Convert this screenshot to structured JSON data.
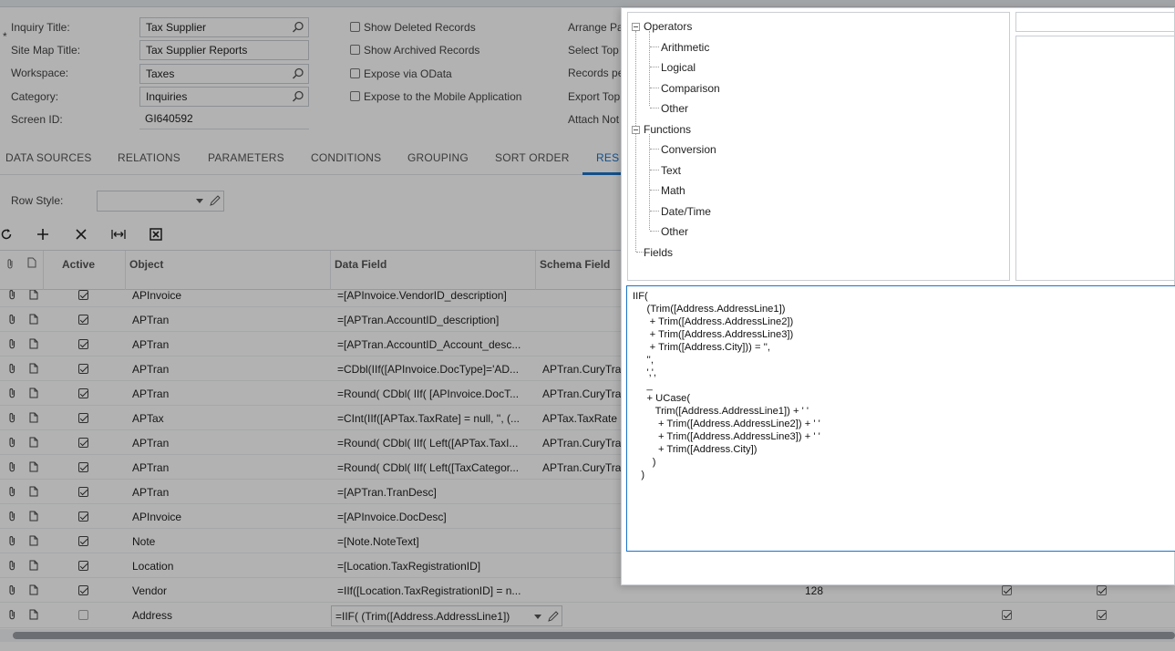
{
  "form": {
    "inquiry_title_label": "Inquiry Title:",
    "inquiry_title_value": "Tax Supplier",
    "site_map_title_label": "Site Map Title:",
    "site_map_title_value": "Tax Supplier Reports",
    "workspace_label": "Workspace:",
    "workspace_value": "Taxes",
    "category_label": "Category:",
    "category_value": "Inquiries",
    "screen_id_label": "Screen ID:",
    "screen_id_value": "GI640592",
    "checkboxes": [
      {
        "label": "Show Deleted Records",
        "checked": false
      },
      {
        "label": "Show Archived Records",
        "checked": false
      },
      {
        "label": "Expose via OData",
        "checked": false
      },
      {
        "label": "Expose to the Mobile Application",
        "checked": false
      }
    ],
    "right_labels": [
      "Arrange Pa",
      "Select Top",
      "Records pe",
      "Export Top",
      "Attach Not"
    ]
  },
  "tabs": [
    "DATA SOURCES",
    "RELATIONS",
    "PARAMETERS",
    "CONDITIONS",
    "GROUPING",
    "SORT ORDER",
    "RES"
  ],
  "active_tab": "RES",
  "row_style_label": "Row Style:",
  "grid": {
    "headers": {
      "active": "Active",
      "object": "Object",
      "data_field": "Data Field",
      "schema_field": "Schema Field"
    },
    "rows": [
      {
        "active": true,
        "object": "APInvoice",
        "data_field": "=[APInvoice.VendorID_description]",
        "schema_field": "",
        "extra": ""
      },
      {
        "active": true,
        "object": "APTran",
        "data_field": "=[APTran.AccountID_description]",
        "schema_field": "",
        "extra": ""
      },
      {
        "active": true,
        "object": "APTran",
        "data_field": "=[APTran.AccountID_Account_desc...",
        "schema_field": "",
        "extra": ""
      },
      {
        "active": true,
        "object": "APTran",
        "data_field": "=CDbl(IIf([APInvoice.DocType]='AD...",
        "schema_field": "APTran.CuryTra",
        "extra": ""
      },
      {
        "active": true,
        "object": "APTran",
        "data_field": "=Round( CDbl( IIf( [APInvoice.DocT...",
        "schema_field": "APTran.CuryTra",
        "extra": ""
      },
      {
        "active": true,
        "object": "APTax",
        "data_field": "=CInt(IIf([APTax.TaxRate] = null, '', (...",
        "schema_field": "APTax.TaxRate",
        "extra": ""
      },
      {
        "active": true,
        "object": "APTran",
        "data_field": "=Round( CDbl( IIf( Left([APTax.TaxI...",
        "schema_field": "APTran.CuryTra",
        "extra": ""
      },
      {
        "active": true,
        "object": "APTran",
        "data_field": "=Round( CDbl( IIf( Left([TaxCategor...",
        "schema_field": "APTran.CuryTra",
        "extra": ""
      },
      {
        "active": true,
        "object": "APTran",
        "data_field": "=[APTran.TranDesc]",
        "schema_field": "",
        "extra": ""
      },
      {
        "active": true,
        "object": "APInvoice",
        "data_field": "=[APInvoice.DocDesc]",
        "schema_field": "",
        "extra": ""
      },
      {
        "active": true,
        "object": "Note",
        "data_field": "=[Note.NoteText]",
        "schema_field": "",
        "extra": ""
      },
      {
        "active": true,
        "object": "Location",
        "data_field": "=[Location.TaxRegistrationID]",
        "schema_field": "",
        "extra": ""
      },
      {
        "active": true,
        "object": "Vendor",
        "data_field": "=IIf([Location.TaxRegistrationID] = n...",
        "schema_field": "",
        "extra": "128"
      },
      {
        "active": false,
        "object": "Address",
        "data_field": "=IIF(     (Trim([Address.AddressLine1])",
        "schema_field": "",
        "extra": ""
      }
    ]
  },
  "dialog": {
    "tree": {
      "operators": "Operators",
      "operator_children": [
        "Arithmetic",
        "Logical",
        "Comparison",
        "Other"
      ],
      "functions": "Functions",
      "function_children": [
        "Conversion",
        "Text",
        "Math",
        "Date/Time",
        "Other"
      ],
      "fields": "Fields"
    },
    "code_lines": [
      "IIF(",
      "     (Trim([Address.AddressLine1])",
      "      + Trim([Address.AddressLine2])",
      "      + Trim([Address.AddressLine3])",
      "      + Trim([Address.City])) = '',",
      "     '',",
      "     ',',",
      "     _",
      "     + UCase(",
      "        Trim([Address.AddressLine1]) + ' '",
      "         + Trim([Address.AddressLine2]) + ' '",
      "         + Trim([Address.AddressLine3]) + ' '",
      "         + Trim([Address.City])",
      "       )",
      "   )"
    ]
  }
}
